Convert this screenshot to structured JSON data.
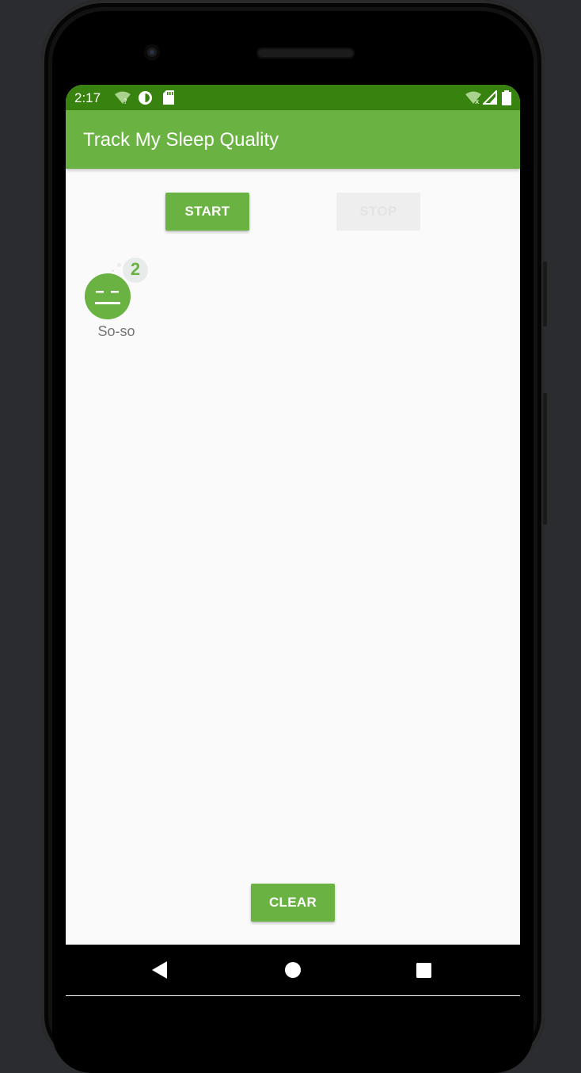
{
  "status_bar": {
    "time": "2:17",
    "left_icons": [
      "wifi-unknown-icon",
      "data-saver-icon",
      "sd-card-icon"
    ],
    "right_icons": [
      "wifi-no-internet-icon",
      "cell-signal-icon",
      "battery-icon"
    ]
  },
  "app_bar": {
    "title": "Track My Sleep Quality"
  },
  "buttons": {
    "start_label": "START",
    "stop_label": "STOP",
    "clear_label": "CLEAR"
  },
  "sleep_nights": [
    {
      "quality_label": "So-so",
      "badge": "2",
      "icon": "so-so-face-icon"
    }
  ],
  "nav_bar": {
    "icons": [
      "back-icon",
      "home-icon",
      "recents-icon"
    ]
  },
  "colors": {
    "primary": "#6ab343",
    "primary_dark": "#38820f",
    "background": "#fafafa"
  }
}
